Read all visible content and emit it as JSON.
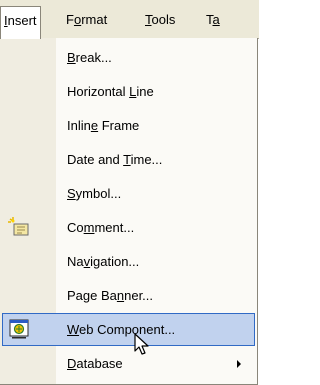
{
  "menubar": {
    "items": [
      {
        "pre": "",
        "ul": "I",
        "post": "nsert"
      },
      {
        "pre": "F",
        "ul": "o",
        "post": "rmat"
      },
      {
        "pre": "",
        "ul": "T",
        "post": "ools"
      },
      {
        "pre": "T",
        "ul": "a",
        "post": ""
      }
    ]
  },
  "menu": {
    "items": [
      {
        "pre": "",
        "ul": "B",
        "post": "reak..."
      },
      {
        "pre": "Horizontal ",
        "ul": "L",
        "post": "ine"
      },
      {
        "pre": "Inlin",
        "ul": "e",
        "post": " Frame"
      },
      {
        "pre": "Date and ",
        "ul": "T",
        "post": "ime..."
      },
      {
        "pre": "",
        "ul": "S",
        "post": "ymbol..."
      },
      {
        "pre": "Co",
        "ul": "m",
        "post": "ment..."
      },
      {
        "pre": "Na",
        "ul": "v",
        "post": "igation..."
      },
      {
        "pre": "Page Ba",
        "ul": "n",
        "post": "ner..."
      },
      {
        "pre": "",
        "ul": "W",
        "post": "eb Component..."
      },
      {
        "pre": "",
        "ul": "D",
        "post": "atabase"
      }
    ],
    "icons": {
      "comment": "comment-icon",
      "web_component": "web-component-icon",
      "database_submenu": "submenu-arrow-icon"
    },
    "highlighted_item": "Web Component..."
  },
  "colors": {
    "menubar_bg": "#ece9d8",
    "menu_bg": "#fbfaf6",
    "icon_strip": "#f0ede1",
    "highlight_bg": "#c1d2ee",
    "highlight_border": "#316ac5"
  }
}
